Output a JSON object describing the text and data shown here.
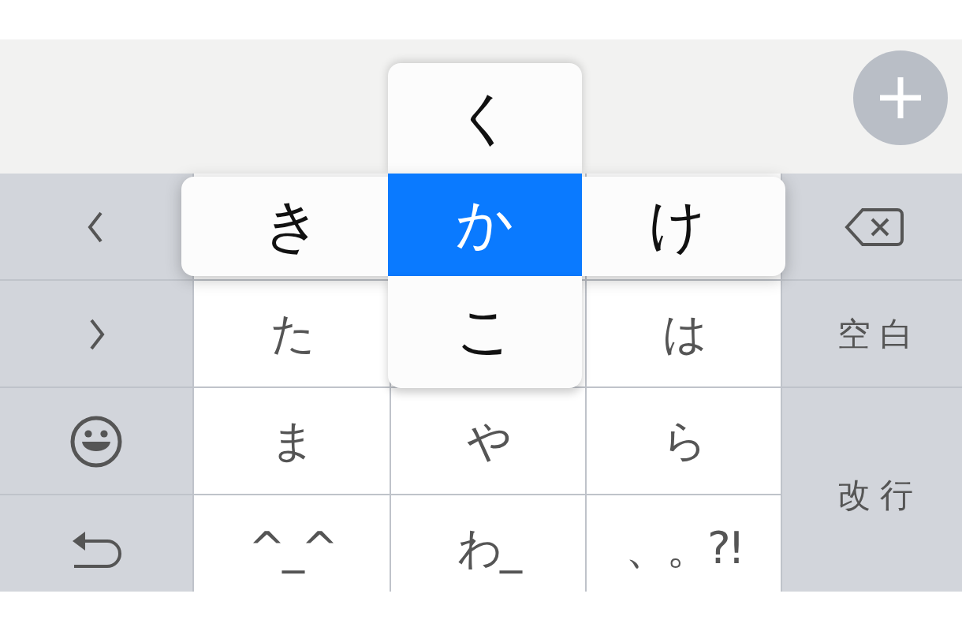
{
  "keyboard": {
    "left_keys": [
      {
        "kind": "back"
      },
      {
        "kind": "forward"
      },
      {
        "kind": "emoji"
      },
      {
        "kind": "undo"
      }
    ],
    "right_keys": [
      {
        "kind": "delete"
      },
      {
        "kind": "text",
        "label": "空白"
      },
      {
        "kind": "text",
        "label": "改行"
      }
    ],
    "kana_rows": [
      [
        null,
        null,
        null
      ],
      [
        "た",
        null,
        "は"
      ],
      [
        "ま",
        "や",
        "ら"
      ],
      [
        "^_^",
        "わ_",
        "、。?!"
      ]
    ]
  },
  "flick_popup": [
    {
      "kind": "up",
      "label": "く",
      "selected": false
    },
    {
      "kind": "left",
      "label": "き",
      "selected": false
    },
    {
      "kind": "center",
      "label": "か",
      "selected": true
    },
    {
      "kind": "right",
      "label": "け",
      "selected": false
    },
    {
      "kind": "down",
      "label": "こ",
      "selected": false
    }
  ]
}
